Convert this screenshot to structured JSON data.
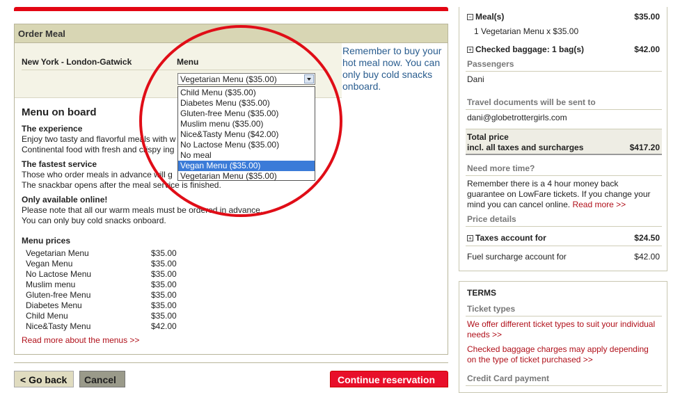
{
  "order": {
    "title": "Order Meal",
    "route": "New York - London-Gatwick",
    "menu_label": "Menu",
    "selected": "Vegetarian Menu ($35.00)",
    "options": [
      "Child Menu ($35.00)",
      "Diabetes Menu ($35.00)",
      "Gluten-free Menu ($35.00)",
      "Muslim menu ($35.00)",
      "Nice&Tasty Menu ($42.00)",
      "No Lactose Menu ($35.00)",
      "No meal",
      "Vegan Menu ($35.00)",
      "Vegetarian Menu ($35.00)"
    ],
    "highlighted": "Vegan Menu ($35.00)",
    "reminder": "Remember to buy your hot meal now. You can only buy cold snacks onboard."
  },
  "info": {
    "heading": "Menu on board",
    "experience_title": "The experience",
    "experience_l1": "Enjoy two tasty and flavorful meals with w",
    "experience_l2": "Continental food with fresh and crispy ing",
    "fastest_title": "The fastest service",
    "fastest_l1": "Those who order meals in advance will g",
    "fastest_l2": "The snackbar opens after the meal service is finished.",
    "online_title": "Only available online!",
    "online_l1": "Please note that all our warm meals must be ordered in advance.",
    "online_l2": "You can only buy cold snacks onboard.",
    "prices_title": "Menu prices",
    "prices": [
      {
        "name": "Vegetarian Menu",
        "price": "$35.00"
      },
      {
        "name": "Vegan Menu",
        "price": "$35.00"
      },
      {
        "name": "No Lactose Menu",
        "price": "$35.00"
      },
      {
        "name": "Muslim menu",
        "price": "$35.00"
      },
      {
        "name": "Gluten-free Menu",
        "price": "$35.00"
      },
      {
        "name": "Diabetes Menu",
        "price": "$35.00"
      },
      {
        "name": "Child Menu",
        "price": "$35.00"
      },
      {
        "name": "Nice&Tasty Menu",
        "price": "$42.00"
      }
    ],
    "read_more": "Read more about the menus >>"
  },
  "buttons": {
    "back": "< Go back",
    "cancel": "Cancel",
    "continue": "Continue reservation"
  },
  "summary": {
    "meals_label": "Meal(s)",
    "meals_price": "$35.00",
    "meals_detail": "1 Vegetarian Menu x $35.00",
    "baggage_label": "Checked baggage: 1 bag(s)",
    "baggage_price": "$42.00",
    "passengers_title": "Passengers",
    "passenger": "Dani",
    "docs_title": "Travel documents will be sent to",
    "email": "dani@globetrottergirls.com",
    "total_l1": "Total price",
    "total_l2": "incl. all taxes and surcharges",
    "total_price": "$417.20",
    "more_time_title": "Need more time?",
    "more_time_l1": "Remember there is a 4 hour money back",
    "more_time_l2": "guarantee on LowFare tickets. If you change your",
    "more_time_l3": "mind you can cancel online.",
    "more_time_link": "Read more >>",
    "price_details_title": "Price details",
    "taxes_label": "Taxes account for",
    "taxes_price": "$24.50",
    "fuel_label": "Fuel surcharge account for",
    "fuel_price": "$42.00"
  },
  "terms": {
    "title": "TERMS",
    "ticket_types_title": "Ticket types",
    "ticket_l1": "We offer different ticket types to suit your individual",
    "ticket_l2": "needs >>",
    "baggage_l1": "Checked baggage charges may apply depending",
    "baggage_l2": "on the type of ticket purchased >>",
    "cc_title": "Credit Card payment"
  },
  "colors": {
    "accent_red": "#e30613",
    "panel_header": "#d8d6b4",
    "link_red": "#b0101a",
    "reminder_blue": "#2a5d8f",
    "highlight_blue": "#3b7bd8"
  },
  "icons": {
    "collapse": "minus-box-icon",
    "expand": "plus-box-icon",
    "dropdown": "chevron-down-icon"
  }
}
